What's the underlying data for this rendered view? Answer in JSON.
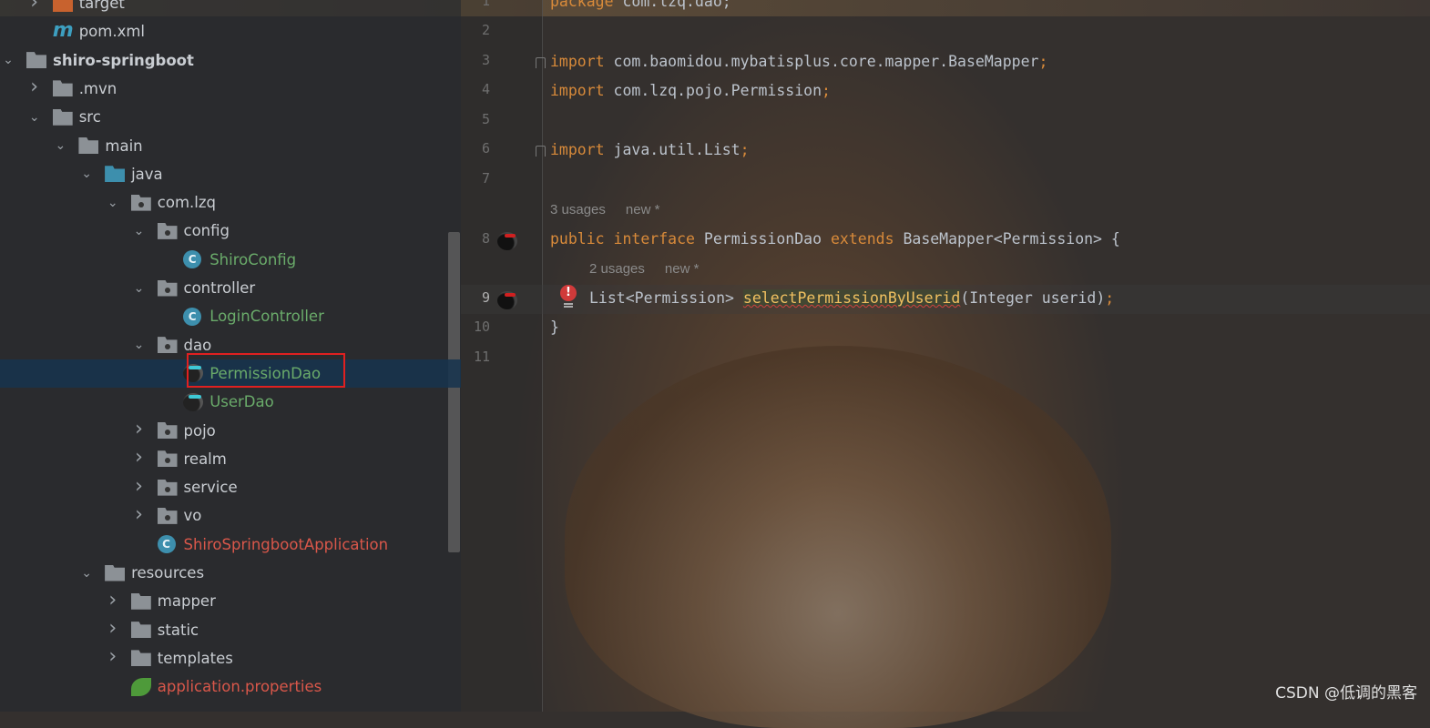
{
  "project_tree": [
    {
      "label": "target",
      "depth": 1,
      "chevron": "right",
      "icon": "excluded-folder-icon",
      "color": "normal"
    },
    {
      "label": "pom.xml",
      "depth": 1,
      "chevron": "",
      "icon": "maven-icon",
      "color": "normal"
    },
    {
      "label": "shiro-springboot",
      "depth": 0,
      "chevron": "down",
      "icon": "module-folder-icon",
      "color": "bold"
    },
    {
      "label": ".mvn",
      "depth": 1,
      "chevron": "right",
      "icon": "folder-icon",
      "color": "normal"
    },
    {
      "label": "src",
      "depth": 1,
      "chevron": "down",
      "icon": "folder-icon",
      "color": "normal"
    },
    {
      "label": "main",
      "depth": 2,
      "chevron": "down",
      "icon": "folder-icon",
      "color": "normal"
    },
    {
      "label": "java",
      "depth": 3,
      "chevron": "down",
      "icon": "source-folder-icon",
      "color": "normal"
    },
    {
      "label": "com.lzq",
      "depth": 4,
      "chevron": "down",
      "icon": "package-icon",
      "color": "normal"
    },
    {
      "label": "config",
      "depth": 5,
      "chevron": "down",
      "icon": "package-icon",
      "color": "normal"
    },
    {
      "label": "ShiroConfig",
      "depth": 6,
      "chevron": "",
      "icon": "class-icon",
      "color": "green"
    },
    {
      "label": "controller",
      "depth": 5,
      "chevron": "down",
      "icon": "package-icon",
      "color": "normal"
    },
    {
      "label": "LoginController",
      "depth": 6,
      "chevron": "",
      "icon": "class-icon",
      "color": "green"
    },
    {
      "label": "dao",
      "depth": 5,
      "chevron": "down",
      "icon": "package-icon",
      "color": "normal"
    },
    {
      "label": "PermissionDao",
      "depth": 6,
      "chevron": "",
      "icon": "mapper-interface-icon",
      "color": "green",
      "selected": true
    },
    {
      "label": "UserDao",
      "depth": 6,
      "chevron": "",
      "icon": "mapper-interface-icon",
      "color": "green"
    },
    {
      "label": "pojo",
      "depth": 5,
      "chevron": "right",
      "icon": "package-icon",
      "color": "normal"
    },
    {
      "label": "realm",
      "depth": 5,
      "chevron": "right",
      "icon": "package-icon",
      "color": "normal"
    },
    {
      "label": "service",
      "depth": 5,
      "chevron": "right",
      "icon": "package-icon",
      "color": "normal"
    },
    {
      "label": "vo",
      "depth": 5,
      "chevron": "right",
      "icon": "package-icon",
      "color": "normal"
    },
    {
      "label": "ShiroSpringbootApplication",
      "depth": 5,
      "chevron": "",
      "icon": "spring-boot-app-icon",
      "color": "red"
    },
    {
      "label": "resources",
      "depth": 3,
      "chevron": "down",
      "icon": "resources-folder-icon",
      "color": "normal"
    },
    {
      "label": "mapper",
      "depth": 4,
      "chevron": "right",
      "icon": "folder-icon",
      "color": "normal"
    },
    {
      "label": "static",
      "depth": 4,
      "chevron": "right",
      "icon": "folder-icon",
      "color": "normal"
    },
    {
      "label": "templates",
      "depth": 4,
      "chevron": "right",
      "icon": "folder-icon",
      "color": "normal"
    },
    {
      "label": "application.properties",
      "depth": 4,
      "chevron": "",
      "icon": "spring-properties-icon",
      "color": "red"
    }
  ],
  "editor": {
    "line_numbers": [
      "1",
      "2",
      "3",
      "4",
      "5",
      "6",
      "7",
      "8",
      "9",
      "10",
      "11"
    ],
    "line1": {
      "kw": "package",
      "rest": " com.lzq.dao;"
    },
    "line3": {
      "kw": "import",
      "rest": " com.baomidou.mybatisplus.core.mapper.BaseMapper",
      "semi": ";"
    },
    "line4": {
      "kw": "import",
      "rest": " com.lzq.pojo.Permission",
      "semi": ";"
    },
    "line6": {
      "kw": "import",
      "rest": " java.util.List",
      "semi": ";"
    },
    "hint1": {
      "usages": "3 usages",
      "author": "new *"
    },
    "line8": {
      "kw1": "public",
      "kw2": " interface",
      "name": " PermissionDao",
      "kw3": " extends",
      "rest": " BaseMapper<Permission> {"
    },
    "hint2": {
      "usages": "2 usages",
      "author": "new *"
    },
    "line9": {
      "pre": "List<Permission> ",
      "method": "selectPermissionByUserid",
      "post": "(Integer userid)",
      "semi": ";"
    },
    "line10": "}"
  },
  "watermark": "CSDN @低调的黑客",
  "colors": {
    "keyword": "#d88a3a",
    "method": "#f0c060",
    "class_green": "#6aab6a",
    "error_red": "#d9574a",
    "selection": "#16344e",
    "highlight_box": "#e02020"
  }
}
